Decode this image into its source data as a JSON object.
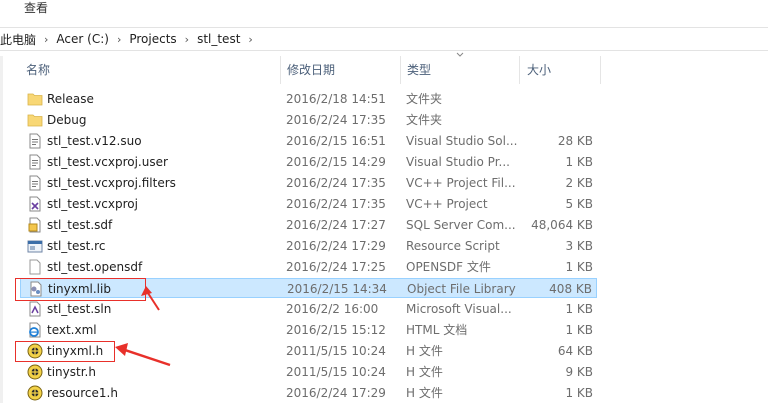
{
  "ribbon": {
    "view_tab": "查看"
  },
  "breadcrumb": [
    "此电脑",
    "Acer (C:)",
    "Projects",
    "stl_test"
  ],
  "columns": {
    "name": "名称",
    "date": "修改日期",
    "type": "类型",
    "size": "大小"
  },
  "files": [
    {
      "name": "Release",
      "date": "2016/2/18 14:51",
      "type": "文件夹",
      "size": "",
      "icon": "folder-icon"
    },
    {
      "name": "Debug",
      "date": "2016/2/24 17:35",
      "type": "文件夹",
      "size": "",
      "icon": "folder-icon"
    },
    {
      "name": "stl_test.v12.suo",
      "date": "2016/2/15 16:51",
      "type": "Visual Studio Sol...",
      "size": "28 KB",
      "icon": "file-icon"
    },
    {
      "name": "stl_test.vcxproj.user",
      "date": "2016/2/15 14:29",
      "type": "Visual Studio Pr...",
      "size": "1 KB",
      "icon": "file-icon"
    },
    {
      "name": "stl_test.vcxproj.filters",
      "date": "2016/2/24 17:35",
      "type": "VC++ Project Fil...",
      "size": "2 KB",
      "icon": "file-icon"
    },
    {
      "name": "stl_test.vcxproj",
      "date": "2016/2/24 17:35",
      "type": "VC++ Project",
      "size": "5 KB",
      "icon": "vcxproj-icon"
    },
    {
      "name": "stl_test.sdf",
      "date": "2016/2/24 17:27",
      "type": "SQL Server Com...",
      "size": "48,064 KB",
      "icon": "sdf-icon"
    },
    {
      "name": "stl_test.rc",
      "date": "2016/2/24 17:29",
      "type": "Resource Script",
      "size": "3 KB",
      "icon": "rc-icon"
    },
    {
      "name": "stl_test.opensdf",
      "date": "2016/2/24 17:25",
      "type": "OPENSDF 文件",
      "size": "1 KB",
      "icon": "blank-file-icon"
    },
    {
      "name": "tinyxml.lib",
      "date": "2016/2/15 14:34",
      "type": "Object File Library",
      "size": "408 KB",
      "icon": "lib-icon",
      "selected": true
    },
    {
      "name": "stl_test.sln",
      "date": "2016/2/2 16:00",
      "type": "Microsoft Visual...",
      "size": "1 KB",
      "icon": "sln-icon"
    },
    {
      "name": "text.xml",
      "date": "2016/2/15 15:12",
      "type": "HTML 文档",
      "size": "1 KB",
      "icon": "ie-icon"
    },
    {
      "name": "tinyxml.h",
      "date": "2011/5/15 10:24",
      "type": "H 文件",
      "size": "64 KB",
      "icon": "header-icon"
    },
    {
      "name": "tinystr.h",
      "date": "2011/5/15 10:24",
      "type": "H 文件",
      "size": "9 KB",
      "icon": "header-icon"
    },
    {
      "name": "resource1.h",
      "date": "2016/2/24 17:29",
      "type": "H 文件",
      "size": "1 KB",
      "icon": "header-icon"
    }
  ],
  "colors": {
    "selection": "#cce8ff",
    "annotation": "#e8302a",
    "folder": "#f8d775"
  }
}
